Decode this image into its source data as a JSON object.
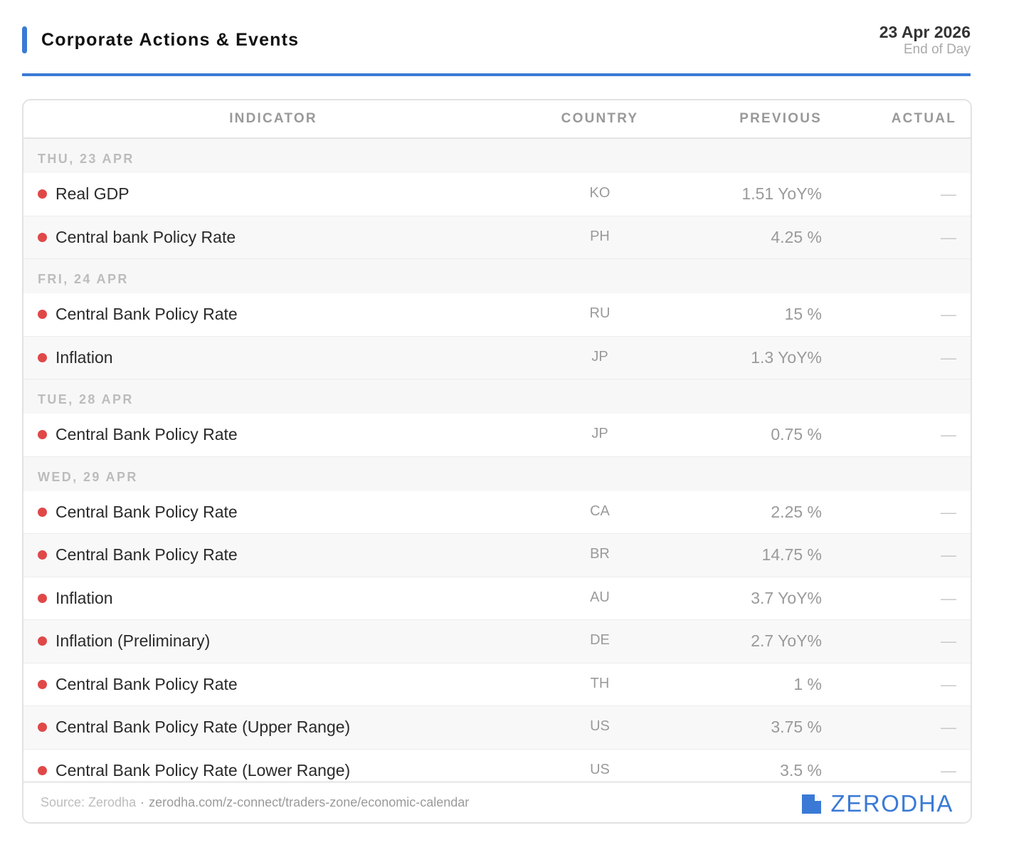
{
  "header": {
    "title": "Corporate Actions & Events",
    "date": "23 Apr 2026",
    "subtitle": "End of Day",
    "accent_color": "#3a7ad6"
  },
  "table": {
    "columns": {
      "indicator": "INDICATOR",
      "country": "COUNTRY",
      "previous": "PREVIOUS",
      "actual": "ACTUAL"
    },
    "groups": [
      {
        "label": "THU, 23 APR",
        "rows": [
          {
            "indicator": "Real GDP",
            "country": "KO",
            "previous": "1.51 YoY%",
            "actual": "—"
          },
          {
            "indicator": "Central bank Policy Rate",
            "country": "PH",
            "previous": "4.25 %",
            "actual": "—"
          }
        ]
      },
      {
        "label": "FRI, 24 APR",
        "rows": [
          {
            "indicator": "Central Bank Policy Rate",
            "country": "RU",
            "previous": "15 %",
            "actual": "—"
          },
          {
            "indicator": "Inflation",
            "country": "JP",
            "previous": "1.3 YoY%",
            "actual": "—"
          }
        ]
      },
      {
        "label": "TUE, 28 APR",
        "rows": [
          {
            "indicator": "Central Bank Policy Rate",
            "country": "JP",
            "previous": "0.75 %",
            "actual": "—"
          }
        ]
      },
      {
        "label": "WED, 29 APR",
        "rows": [
          {
            "indicator": "Central Bank Policy Rate",
            "country": "CA",
            "previous": "2.25 %",
            "actual": "—"
          },
          {
            "indicator": "Central Bank Policy Rate",
            "country": "BR",
            "previous": "14.75 %",
            "actual": "—"
          },
          {
            "indicator": "Inflation",
            "country": "AU",
            "previous": "3.7 YoY%",
            "actual": "—"
          },
          {
            "indicator": "Inflation (Preliminary)",
            "country": "DE",
            "previous": "2.7 YoY%",
            "actual": "—"
          },
          {
            "indicator": "Central Bank Policy Rate",
            "country": "TH",
            "previous": "1 %",
            "actual": "—"
          },
          {
            "indicator": "Central Bank Policy Rate (Upper Range)",
            "country": "US",
            "previous": "3.75 %",
            "actual": "—"
          },
          {
            "indicator": "Central Bank Policy Rate (Lower Range)",
            "country": "US",
            "previous": "3.5 %",
            "actual": "—"
          }
        ]
      }
    ],
    "impact_dot_color": "#e04848"
  },
  "footer": {
    "source": "Source: Zerodha",
    "separator": "·",
    "url": "zerodha.com/z-connect/traders-zone/economic-calendar",
    "brand": "ZERODHA",
    "brand_icon": "zerodha-logo-icon"
  }
}
